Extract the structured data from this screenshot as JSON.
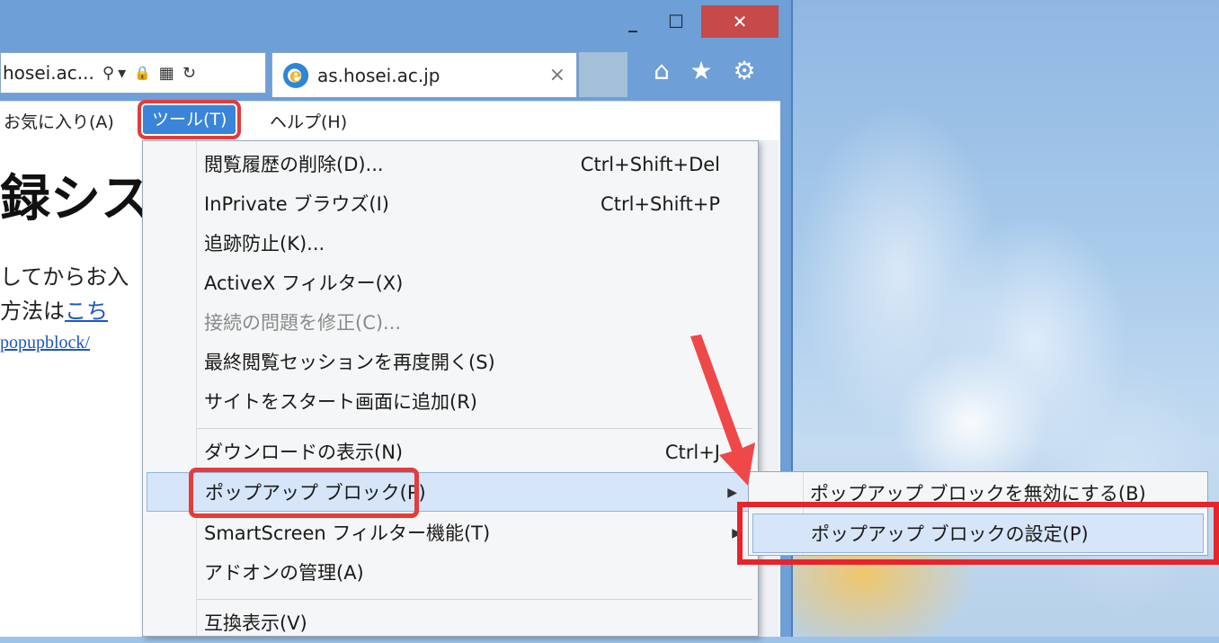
{
  "window": {
    "minimize": "_",
    "maximize": "☐",
    "close": "✕"
  },
  "address_bar": {
    "text": "hosei.ac... ",
    "icons": [
      "search-icon",
      "dropdown-icon",
      "lock-icon",
      "compat-view-icon",
      "refresh-icon"
    ],
    "search_glyph": "⚲",
    "dropdown_glyph": "▾",
    "lock_glyph": "🔒",
    "compat_glyph": "▦",
    "refresh_glyph": "↻"
  },
  "tab": {
    "logo": "e",
    "title": "as.hosei.ac.jp",
    "close": "×"
  },
  "toolbar": {
    "home": "⌂",
    "favorites": "★",
    "settings": "⚙"
  },
  "menu_bar": {
    "favorites": "お気に入り(A)",
    "tools": "ツール(T)",
    "help": "ヘルプ(H)"
  },
  "page": {
    "heading": "録システ",
    "line1": "してからお入",
    "line2_prefix": "方法は",
    "line2_link": "こち",
    "url_link": "popupblock/"
  },
  "tools_menu": {
    "items": [
      {
        "label": "閲覧履歴の削除(D)...",
        "shortcut": "Ctrl+Shift+Del"
      },
      {
        "label": "InPrivate ブラウズ(I)",
        "shortcut": "Ctrl+Shift+P"
      },
      {
        "label": "追跡防止(K)...",
        "shortcut": ""
      },
      {
        "label": "ActiveX フィルター(X)",
        "shortcut": ""
      },
      {
        "label": "接続の問題を修正(C)...",
        "shortcut": ""
      },
      {
        "label": "最終閲覧セッションを再度開く(S)",
        "shortcut": ""
      },
      {
        "label": "サイトをスタート画面に追加(R)",
        "shortcut": ""
      },
      {
        "label": "ダウンロードの表示(N)",
        "shortcut": "Ctrl+J"
      },
      {
        "label": "ポップアップ ブロック(P)",
        "shortcut": ""
      },
      {
        "label": "SmartScreen フィルター機能(T)",
        "shortcut": ""
      },
      {
        "label": "アドオンの管理(A)",
        "shortcut": ""
      },
      {
        "label": "互換表示(V)",
        "shortcut": ""
      }
    ],
    "submenu_arrow": "▶"
  },
  "submenu": {
    "disable": "ポップアップ ブロックを無効にする(B)",
    "settings": "ポップアップ ブロックの設定(P)"
  },
  "colors": {
    "highlight_red": "#e43b3b",
    "menu_hover": "#d6e6f8",
    "titlebar": "#6e9fd6",
    "close_button": "#c74a4a",
    "link": "#1a57c5"
  }
}
